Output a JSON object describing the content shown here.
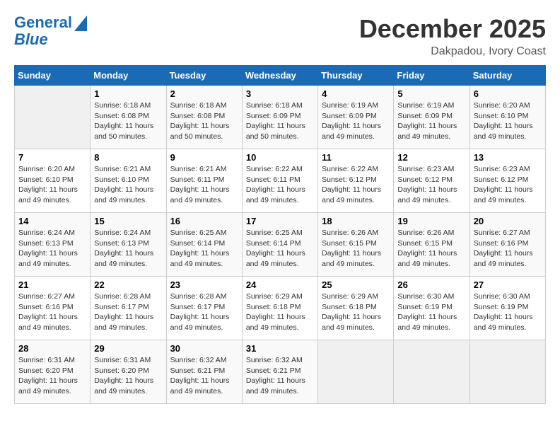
{
  "header": {
    "logo_line1": "General",
    "logo_line2": "Blue",
    "month": "December 2025",
    "location": "Dakpadou, Ivory Coast"
  },
  "days_of_week": [
    "Sunday",
    "Monday",
    "Tuesday",
    "Wednesday",
    "Thursday",
    "Friday",
    "Saturday"
  ],
  "weeks": [
    [
      {
        "day": "",
        "sunrise": "",
        "sunset": "",
        "daylight": ""
      },
      {
        "day": "1",
        "sunrise": "Sunrise: 6:18 AM",
        "sunset": "Sunset: 6:08 PM",
        "daylight": "Daylight: 11 hours and 50 minutes."
      },
      {
        "day": "2",
        "sunrise": "Sunrise: 6:18 AM",
        "sunset": "Sunset: 6:08 PM",
        "daylight": "Daylight: 11 hours and 50 minutes."
      },
      {
        "day": "3",
        "sunrise": "Sunrise: 6:18 AM",
        "sunset": "Sunset: 6:09 PM",
        "daylight": "Daylight: 11 hours and 50 minutes."
      },
      {
        "day": "4",
        "sunrise": "Sunrise: 6:19 AM",
        "sunset": "Sunset: 6:09 PM",
        "daylight": "Daylight: 11 hours and 49 minutes."
      },
      {
        "day": "5",
        "sunrise": "Sunrise: 6:19 AM",
        "sunset": "Sunset: 6:09 PM",
        "daylight": "Daylight: 11 hours and 49 minutes."
      },
      {
        "day": "6",
        "sunrise": "Sunrise: 6:20 AM",
        "sunset": "Sunset: 6:10 PM",
        "daylight": "Daylight: 11 hours and 49 minutes."
      }
    ],
    [
      {
        "day": "7",
        "sunrise": "Sunrise: 6:20 AM",
        "sunset": "Sunset: 6:10 PM",
        "daylight": "Daylight: 11 hours and 49 minutes."
      },
      {
        "day": "8",
        "sunrise": "Sunrise: 6:21 AM",
        "sunset": "Sunset: 6:10 PM",
        "daylight": "Daylight: 11 hours and 49 minutes."
      },
      {
        "day": "9",
        "sunrise": "Sunrise: 6:21 AM",
        "sunset": "Sunset: 6:11 PM",
        "daylight": "Daylight: 11 hours and 49 minutes."
      },
      {
        "day": "10",
        "sunrise": "Sunrise: 6:22 AM",
        "sunset": "Sunset: 6:11 PM",
        "daylight": "Daylight: 11 hours and 49 minutes."
      },
      {
        "day": "11",
        "sunrise": "Sunrise: 6:22 AM",
        "sunset": "Sunset: 6:12 PM",
        "daylight": "Daylight: 11 hours and 49 minutes."
      },
      {
        "day": "12",
        "sunrise": "Sunrise: 6:23 AM",
        "sunset": "Sunset: 6:12 PM",
        "daylight": "Daylight: 11 hours and 49 minutes."
      },
      {
        "day": "13",
        "sunrise": "Sunrise: 6:23 AM",
        "sunset": "Sunset: 6:12 PM",
        "daylight": "Daylight: 11 hours and 49 minutes."
      }
    ],
    [
      {
        "day": "14",
        "sunrise": "Sunrise: 6:24 AM",
        "sunset": "Sunset: 6:13 PM",
        "daylight": "Daylight: 11 hours and 49 minutes."
      },
      {
        "day": "15",
        "sunrise": "Sunrise: 6:24 AM",
        "sunset": "Sunset: 6:13 PM",
        "daylight": "Daylight: 11 hours and 49 minutes."
      },
      {
        "day": "16",
        "sunrise": "Sunrise: 6:25 AM",
        "sunset": "Sunset: 6:14 PM",
        "daylight": "Daylight: 11 hours and 49 minutes."
      },
      {
        "day": "17",
        "sunrise": "Sunrise: 6:25 AM",
        "sunset": "Sunset: 6:14 PM",
        "daylight": "Daylight: 11 hours and 49 minutes."
      },
      {
        "day": "18",
        "sunrise": "Sunrise: 6:26 AM",
        "sunset": "Sunset: 6:15 PM",
        "daylight": "Daylight: 11 hours and 49 minutes."
      },
      {
        "day": "19",
        "sunrise": "Sunrise: 6:26 AM",
        "sunset": "Sunset: 6:15 PM",
        "daylight": "Daylight: 11 hours and 49 minutes."
      },
      {
        "day": "20",
        "sunrise": "Sunrise: 6:27 AM",
        "sunset": "Sunset: 6:16 PM",
        "daylight": "Daylight: 11 hours and 49 minutes."
      }
    ],
    [
      {
        "day": "21",
        "sunrise": "Sunrise: 6:27 AM",
        "sunset": "Sunset: 6:16 PM",
        "daylight": "Daylight: 11 hours and 49 minutes."
      },
      {
        "day": "22",
        "sunrise": "Sunrise: 6:28 AM",
        "sunset": "Sunset: 6:17 PM",
        "daylight": "Daylight: 11 hours and 49 minutes."
      },
      {
        "day": "23",
        "sunrise": "Sunrise: 6:28 AM",
        "sunset": "Sunset: 6:17 PM",
        "daylight": "Daylight: 11 hours and 49 minutes."
      },
      {
        "day": "24",
        "sunrise": "Sunrise: 6:29 AM",
        "sunset": "Sunset: 6:18 PM",
        "daylight": "Daylight: 11 hours and 49 minutes."
      },
      {
        "day": "25",
        "sunrise": "Sunrise: 6:29 AM",
        "sunset": "Sunset: 6:18 PM",
        "daylight": "Daylight: 11 hours and 49 minutes."
      },
      {
        "day": "26",
        "sunrise": "Sunrise: 6:30 AM",
        "sunset": "Sunset: 6:19 PM",
        "daylight": "Daylight: 11 hours and 49 minutes."
      },
      {
        "day": "27",
        "sunrise": "Sunrise: 6:30 AM",
        "sunset": "Sunset: 6:19 PM",
        "daylight": "Daylight: 11 hours and 49 minutes."
      }
    ],
    [
      {
        "day": "28",
        "sunrise": "Sunrise: 6:31 AM",
        "sunset": "Sunset: 6:20 PM",
        "daylight": "Daylight: 11 hours and 49 minutes."
      },
      {
        "day": "29",
        "sunrise": "Sunrise: 6:31 AM",
        "sunset": "Sunset: 6:20 PM",
        "daylight": "Daylight: 11 hours and 49 minutes."
      },
      {
        "day": "30",
        "sunrise": "Sunrise: 6:32 AM",
        "sunset": "Sunset: 6:21 PM",
        "daylight": "Daylight: 11 hours and 49 minutes."
      },
      {
        "day": "31",
        "sunrise": "Sunrise: 6:32 AM",
        "sunset": "Sunset: 6:21 PM",
        "daylight": "Daylight: 11 hours and 49 minutes."
      },
      {
        "day": "",
        "sunrise": "",
        "sunset": "",
        "daylight": ""
      },
      {
        "day": "",
        "sunrise": "",
        "sunset": "",
        "daylight": ""
      },
      {
        "day": "",
        "sunrise": "",
        "sunset": "",
        "daylight": ""
      }
    ]
  ]
}
